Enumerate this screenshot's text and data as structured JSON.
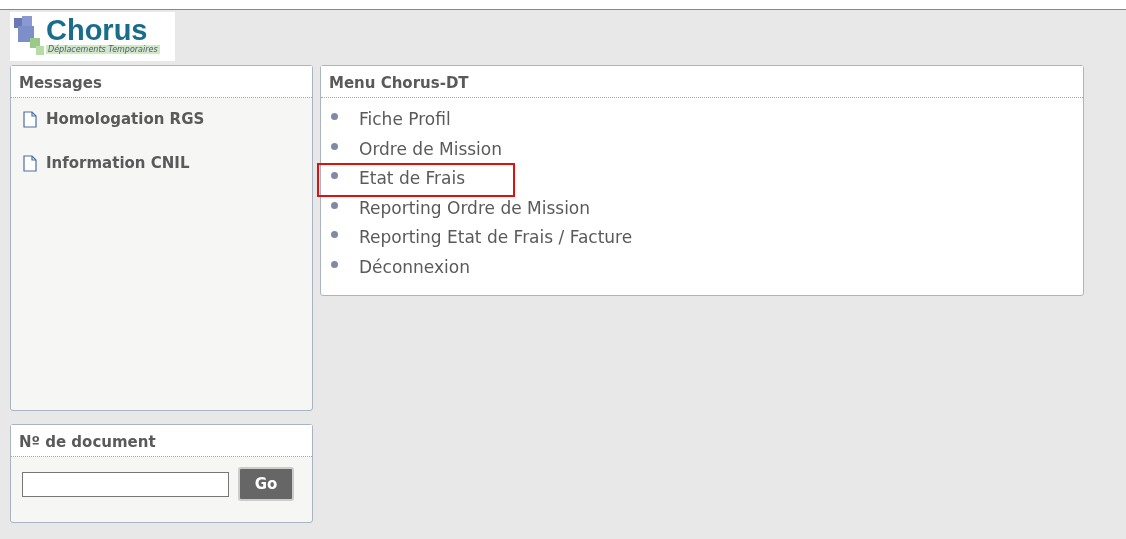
{
  "logo": {
    "name": "Chorus",
    "subtitle": "Déplacements Temporaires"
  },
  "messages": {
    "title": "Messages",
    "items": [
      {
        "label": "Homologation RGS"
      },
      {
        "label": "Information CNIL"
      }
    ]
  },
  "menu": {
    "title": "Menu Chorus-DT",
    "items": [
      {
        "label": "Fiche Profil",
        "highlighted": false
      },
      {
        "label": "Ordre de Mission",
        "highlighted": false
      },
      {
        "label": "Etat de Frais",
        "highlighted": true
      },
      {
        "label": "Reporting Ordre de Mission",
        "highlighted": false
      },
      {
        "label": "Reporting Etat de Frais / Facture",
        "highlighted": false
      },
      {
        "label": "Déconnexion",
        "highlighted": false
      }
    ]
  },
  "document": {
    "title": "Nº de document",
    "button": "Go"
  }
}
